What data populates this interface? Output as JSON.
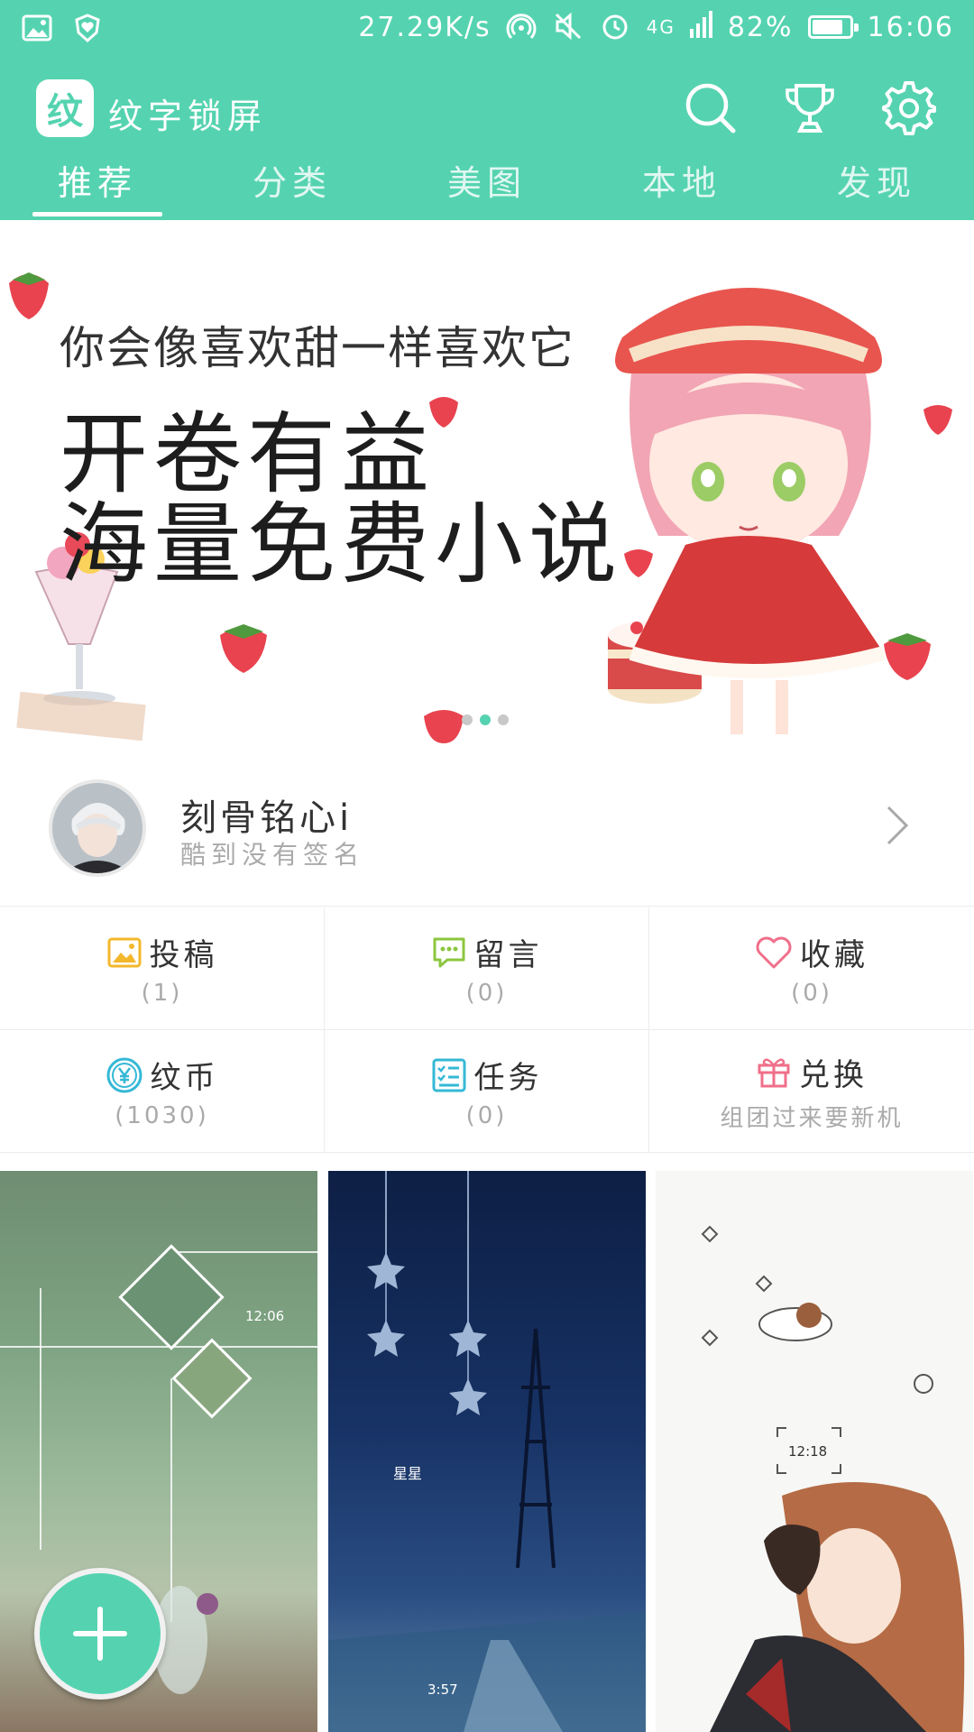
{
  "status_bar": {
    "network_speed": "27.29K/s",
    "network_type": "4G",
    "battery_percent": "82%",
    "battery_level": 0.82,
    "time": "16:06",
    "icons": [
      "image-icon",
      "shield-heart-icon",
      "hotspot-icon",
      "mute-icon",
      "alarm-icon",
      "signal-icon",
      "battery-icon"
    ]
  },
  "app": {
    "logo_char": "纹",
    "title": "纹字锁屏",
    "accent_color": "#55d3b0"
  },
  "top_actions": [
    "search-icon",
    "trophy-icon",
    "gear-icon"
  ],
  "tabs": [
    {
      "label": "推荐",
      "active": true
    },
    {
      "label": "分类",
      "active": false
    },
    {
      "label": "美图",
      "active": false
    },
    {
      "label": "本地",
      "active": false
    },
    {
      "label": "发现",
      "active": false
    }
  ],
  "banner": {
    "line1": "你会像喜欢甜一样喜欢它",
    "line2": "开卷有益",
    "line3": "海量免费小说",
    "page_count": 3,
    "current_page": 2
  },
  "profile": {
    "username": "刻骨铭心i",
    "signature": "酷到没有签名"
  },
  "grid": [
    {
      "label": "投稿",
      "value": "(1)",
      "icon": "image-icon",
      "color": "#f3b72b"
    },
    {
      "label": "留言",
      "value": "(0)",
      "icon": "comment-icon",
      "color": "#8cc63f"
    },
    {
      "label": "收藏",
      "value": "(0)",
      "icon": "heart-icon",
      "color": "#f06f8a"
    },
    {
      "label": "纹币",
      "value": "(1030)",
      "icon": "yen-coin-icon",
      "color": "#35b8d6"
    },
    {
      "label": "任务",
      "value": "(0)",
      "icon": "task-list-icon",
      "color": "#35b8d6"
    },
    {
      "label": "兑换",
      "value": "组团过来要新机",
      "icon": "gift-icon",
      "color": "#f06f8a"
    }
  ],
  "thumbnails": {
    "t1": {
      "time": "12:06"
    },
    "t2": {
      "title": "星星",
      "time": "3:57"
    },
    "t3": {
      "time": "12:18"
    }
  },
  "fab": {
    "icon": "plus-icon"
  }
}
